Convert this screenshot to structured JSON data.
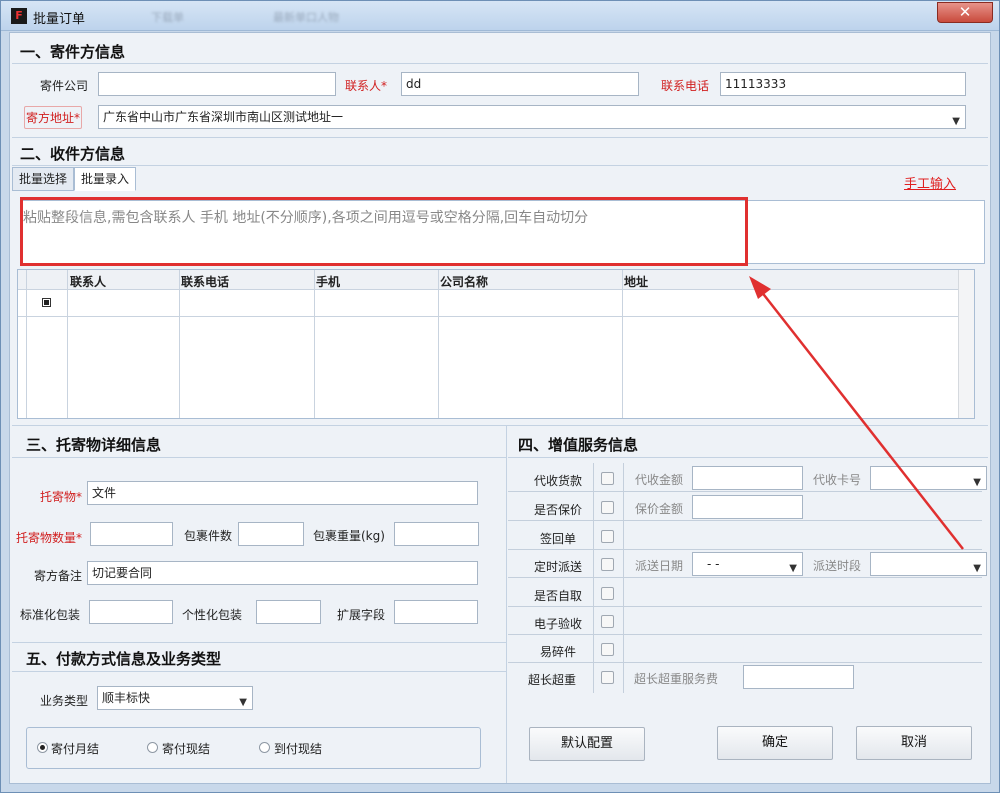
{
  "window": {
    "title": "批量订单",
    "logo": "F",
    "close_label": "✕",
    "ghost_tabs": [
      "下载单",
      "最新单口人物"
    ]
  },
  "sender": {
    "heading": "一、寄件方信息",
    "company_label": "寄件公司",
    "company_value": "",
    "contact_label": "联系人*",
    "contact_value": "dd",
    "phone_label": "联系电话",
    "phone_value": "11113333",
    "address_label": "寄方地址*",
    "address_value": "广东省中山市广东省深圳市南山区测试地址一"
  },
  "receiver": {
    "heading": "二、收件方信息",
    "tabs": [
      "批量选择",
      "批量录入"
    ],
    "active_tab": "批量录入",
    "manual_link": "手工输入",
    "paste_placeholder": "粘贴整段信息,需包含联系人 手机 地址(不分顺序),各项之间用逗号或空格分隔,回车自动切分",
    "columns": [
      "联系人",
      "联系电话",
      "手机",
      "公司名称",
      "地址"
    ]
  },
  "cargo": {
    "heading": "三、托寄物详细信息",
    "item_label": "托寄物*",
    "item_value": "文件",
    "qty_label": "托寄物数量*",
    "qty_value": "",
    "pkg_count_label": "包裹件数",
    "pkg_weight_label": "包裹重量(kg)",
    "remark_label": "寄方备注",
    "remark_value": "切记要合同",
    "std_pkg_label": "标准化包装",
    "custom_pkg_label": "个性化包装",
    "ext_label": "扩展字段"
  },
  "payment": {
    "heading": "五、付款方式信息及业务类型",
    "biz_type_label": "业务类型",
    "biz_type_value": "顺丰标快",
    "options": [
      "寄付月结",
      "寄付现结",
      "到付现结"
    ],
    "selected": "寄付月结"
  },
  "services": {
    "heading": "四、增值服务信息",
    "rows": [
      {
        "label": "代收货款",
        "f1": "代收金额",
        "f2": "代收卡号"
      },
      {
        "label": "是否保价",
        "f1": "保价金额",
        "f2": ""
      },
      {
        "label": "签回单",
        "f1": "",
        "f2": ""
      },
      {
        "label": "定时派送",
        "f1": "派送日期",
        "f1_value": "- -",
        "f2": "派送时段"
      },
      {
        "label": "是否自取",
        "f1": "",
        "f2": ""
      },
      {
        "label": "电子验收",
        "f1": "",
        "f2": ""
      },
      {
        "label": "易碎件",
        "f1": "",
        "f2": ""
      },
      {
        "label": "超长超重",
        "f1": "超长超重服务费",
        "f2": ""
      }
    ]
  },
  "buttons": {
    "default_config": "默认配置",
    "confirm": "确定",
    "cancel": "取消"
  },
  "colors": {
    "annotation_red": "#e03030",
    "required_red": "#d12020"
  }
}
